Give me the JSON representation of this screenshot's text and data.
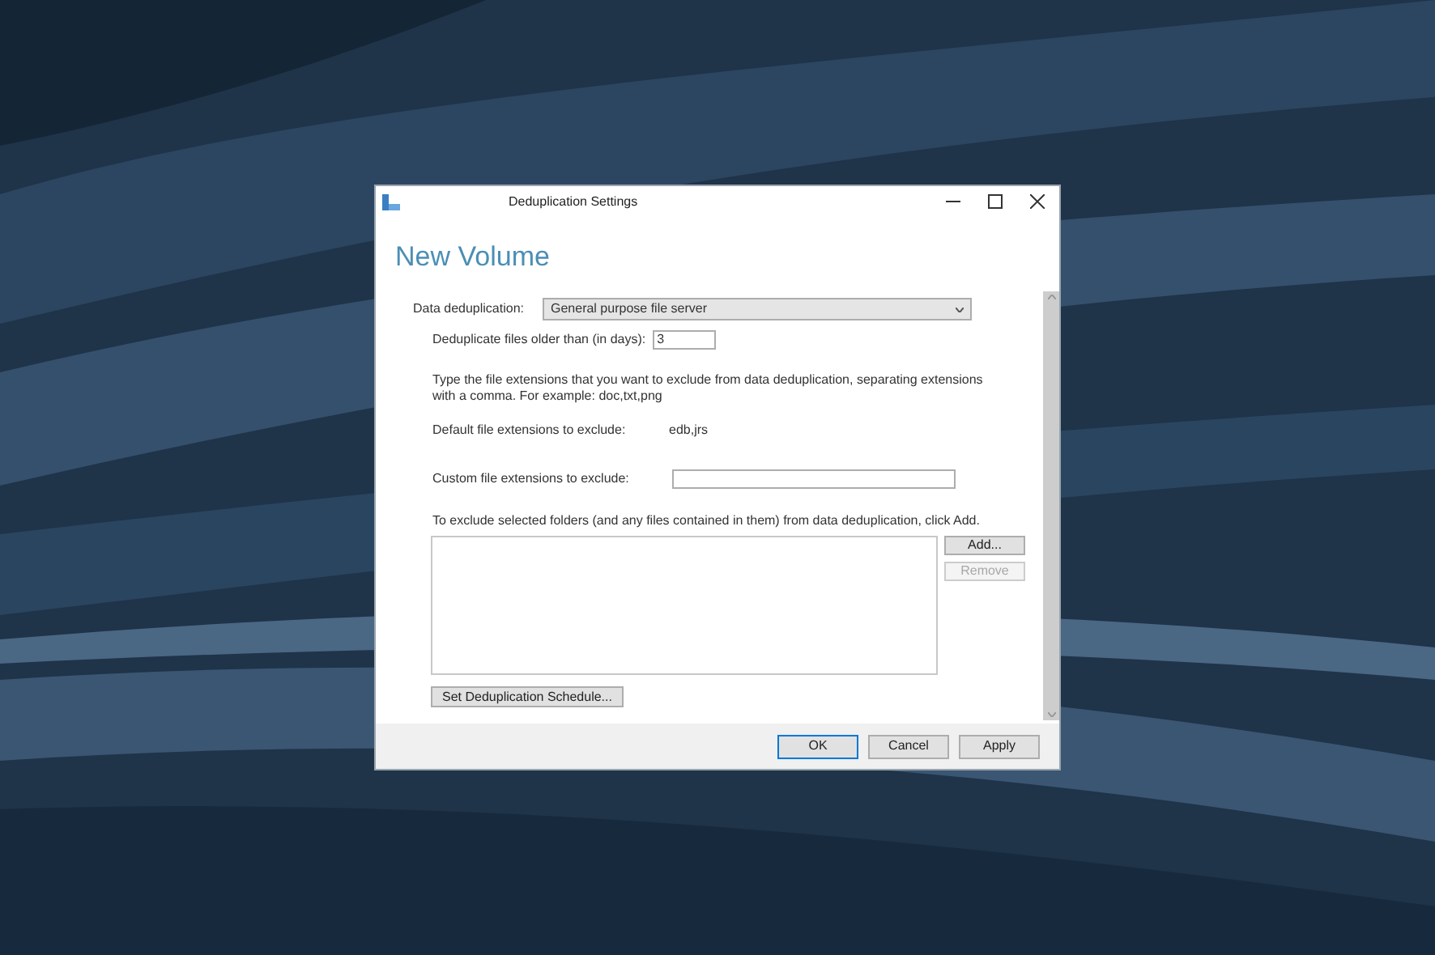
{
  "window": {
    "title": "Deduplication Settings"
  },
  "heading": "New Volume",
  "dedup": {
    "label": "Data deduplication:",
    "value": "General purpose file server"
  },
  "age": {
    "label": "Deduplicate files older than (in days):",
    "value": "3"
  },
  "instructions": "Type the file extensions that you want to exclude from data deduplication, separating extensions with a comma. For example: doc,txt,png",
  "default_ext": {
    "label": "Default file extensions to exclude:",
    "value": "edb,jrs"
  },
  "custom_ext": {
    "label": "Custom file extensions to exclude:"
  },
  "folders": {
    "label": "To exclude selected folders (and any files contained in them) from data deduplication, click Add.",
    "buttons": [
      {
        "label": "Add...",
        "disabled": false
      },
      {
        "label": "Remove",
        "disabled": true
      }
    ]
  },
  "schedule_button": "Set Deduplication Schedule...",
  "footer_buttons": [
    {
      "label": "OK",
      "default": true
    },
    {
      "label": "Cancel",
      "default": false
    },
    {
      "label": "Apply",
      "default": false
    }
  ]
}
